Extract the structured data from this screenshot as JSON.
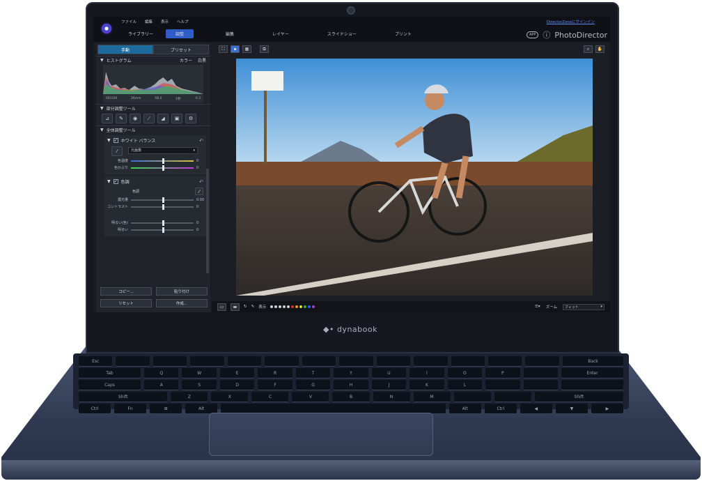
{
  "device": {
    "brand": "dynabook"
  },
  "app": {
    "name": "PhotoDirector",
    "badge": "APP",
    "signin": "DirectorZoneにサインイン",
    "menu": [
      "ファイル",
      "編集",
      "表示",
      "ヘルプ"
    ],
    "modes": [
      {
        "label": "ライブラリー",
        "active": false
      },
      {
        "label": "調整",
        "active": true
      }
    ],
    "work_tabs": [
      "編集",
      "レイヤー",
      "スライドショー",
      "プリント"
    ]
  },
  "left_panel": {
    "subtabs": [
      {
        "label": "手動",
        "active": true
      },
      {
        "label": "プリセット",
        "active": false
      }
    ],
    "histogram": {
      "title": "ヒストグラム",
      "opts": [
        "カラー",
        "白黒"
      ],
      "exif": [
        "ISO100",
        "26mm",
        "f/8.0",
        "1秒",
        "-0.3"
      ]
    },
    "region_tools": {
      "title": "部分調整ツール"
    },
    "global_tools": {
      "title": "全体調整ツール"
    },
    "white_balance": {
      "title": "ホワイト バランス",
      "preset": "元画像",
      "sliders": [
        {
          "label": "色温度",
          "value": "0",
          "pos": 0.5
        },
        {
          "label": "色かぶり",
          "value": "0",
          "pos": 0.5
        }
      ]
    },
    "tone": {
      "title": "色調",
      "sub": "色調",
      "sliders": [
        {
          "label": "露光量",
          "value": "0.00",
          "pos": 0.5
        },
        {
          "label": "コントラスト",
          "value": "0",
          "pos": 0.5
        },
        {
          "label": "明るい(色)",
          "value": "0",
          "pos": 0.5
        },
        {
          "label": "明るい",
          "value": "0",
          "pos": 0.5
        }
      ]
    },
    "buttons": [
      "コピー...",
      "貼り付け",
      "リセット",
      "作成..."
    ]
  },
  "viewer": {
    "filmbar": {
      "zoom_label": "ズーム",
      "zoom_value": "フィット",
      "view": "表示"
    },
    "color_dots": [
      "#cfcfcf",
      "#cfcfcf",
      "#cfcfcf",
      "#cfcfcf",
      "#cfcfcf",
      "#e03030",
      "#e0a030",
      "#e0e030",
      "#30b030",
      "#3060e0",
      "#a040d0"
    ]
  },
  "colors": {
    "accent": "#2f5cc6",
    "body": "#2f3a52"
  }
}
